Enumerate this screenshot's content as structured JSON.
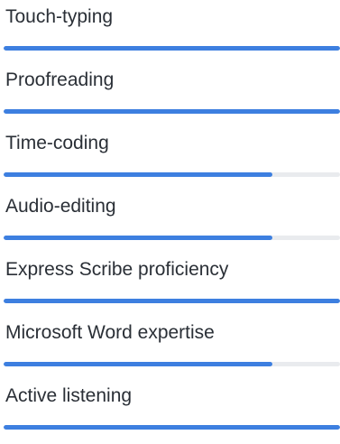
{
  "colors": {
    "bar_fill": "#3d7fe0",
    "bar_track": "#e9ebee",
    "label_text": "#2a2f36"
  },
  "skills": [
    {
      "label": "Touch-typing",
      "level": 1.0
    },
    {
      "label": "Proofreading",
      "level": 1.0
    },
    {
      "label": "Time-coding",
      "level": 0.8
    },
    {
      "label": "Audio-editing",
      "level": 0.8
    },
    {
      "label": "Express Scribe proficiency",
      "level": 1.0
    },
    {
      "label": "Microsoft Word expertise",
      "level": 0.8
    },
    {
      "label": "Active listening",
      "level": 1.0
    }
  ]
}
